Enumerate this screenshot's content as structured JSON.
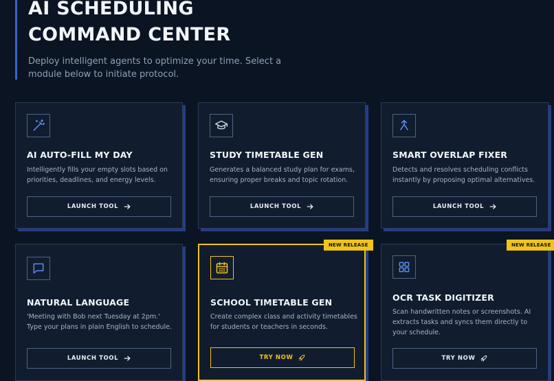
{
  "header": {
    "title_line1": "AI SCHEDULING",
    "title_line2": "COMMAND CENTER",
    "subtitle": "Deploy intelligent agents to optimize your time. Select a module below to initiate protocol."
  },
  "cards": [
    {
      "title": "AI AUTO-FILL MY DAY",
      "icon": "magic-wand-icon",
      "description": "Intelligently fills your empty slots based on priorities, deadlines, and energy levels.",
      "button": "LAUNCH TOOL"
    },
    {
      "title": "STUDY TIMETABLE GEN",
      "icon": "graduation-cap-icon",
      "description": "Generates a balanced study plan for exams, ensuring proper breaks and topic rotation.",
      "button": "LAUNCH TOOL"
    },
    {
      "title": "SMART OVERLAP FIXER",
      "icon": "merge-arrows-icon",
      "description": "Detects and resolves scheduling conflicts instantly by proposing optimal alternatives.",
      "button": "LAUNCH TOOL"
    },
    {
      "title": "NATURAL LANGUAGE",
      "icon": "chat-bubble-icon",
      "description": "'Meeting with Bob next Tuesday at 2pm.' Type your plans in plain English to schedule.",
      "button": "LAUNCH TOOL"
    },
    {
      "title": "SCHOOL TIMETABLE GEN",
      "icon": "calendar-icon",
      "description": "Create complex class and activity timetables for students or teachers in seconds.",
      "button": "TRY NOW",
      "badge": "NEW RELEASE"
    },
    {
      "title": "OCR TASK DIGITIZER",
      "icon": "grid-icon",
      "description": "Scan handwritten notes or screenshots. AI extracts tasks and syncs them directly to your schedule.",
      "button": "TRY NOW",
      "badge": "NEW RELEASE"
    }
  ],
  "colors": {
    "background": "#0b1422",
    "card": "#111d2e",
    "accent_blue": "#3b63c9",
    "accent_yellow": "#f2c419"
  }
}
